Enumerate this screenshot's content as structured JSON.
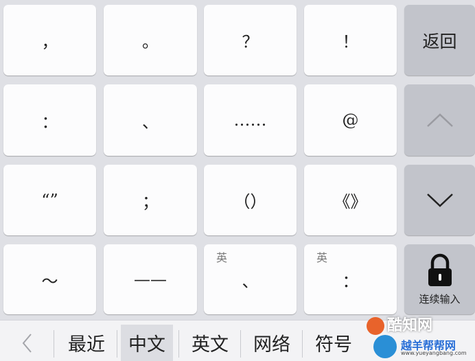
{
  "keys": [
    {
      "label": "，",
      "hint": ""
    },
    {
      "label": "。",
      "hint": ""
    },
    {
      "label": "？",
      "hint": ""
    },
    {
      "label": "！",
      "hint": ""
    },
    {
      "label": "：",
      "hint": ""
    },
    {
      "label": "、",
      "hint": ""
    },
    {
      "label": "……",
      "hint": ""
    },
    {
      "label": "@",
      "hint": ""
    },
    {
      "label": "“”",
      "hint": ""
    },
    {
      "label": "；",
      "hint": ""
    },
    {
      "label": "（）",
      "hint": ""
    },
    {
      "label": "《》",
      "hint": ""
    },
    {
      "label": "～",
      "hint": ""
    },
    {
      "label": "——",
      "hint": ""
    },
    {
      "label": "、",
      "hint": "英"
    },
    {
      "label": "：",
      "hint": "英"
    }
  ],
  "side": {
    "back_label": "返回",
    "up_icon": "chevron-up-icon",
    "down_icon": "chevron-down-icon",
    "lock_label": "连续输入"
  },
  "categories": [
    {
      "label": "最近"
    },
    {
      "label": "中文"
    },
    {
      "label": "英文"
    },
    {
      "label": "网络"
    },
    {
      "label": "符号"
    }
  ],
  "active_category": "中文",
  "watermark": {
    "main": "酷知网",
    "sub": "越羊帮帮网",
    "url": "www.yueyangbang.com"
  },
  "colors": {
    "key": "#fcfcfd",
    "side_key": "#c2c4cb",
    "background": "#dfe0e5"
  }
}
